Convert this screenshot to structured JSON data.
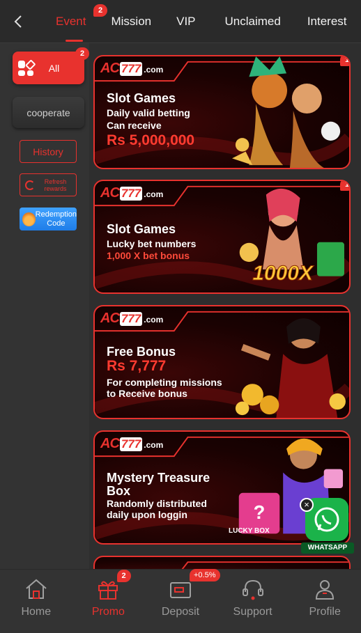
{
  "topbar": {
    "tabs": [
      {
        "label": "Event",
        "badge": "2",
        "active": true
      },
      {
        "label": "Mission"
      },
      {
        "label": "VIP"
      },
      {
        "label": "Unclaimed"
      },
      {
        "label": "Interest"
      }
    ]
  },
  "sidebar": {
    "all": {
      "label": "All",
      "badge": "2"
    },
    "cooperate": {
      "label": "cooperate"
    },
    "history": {
      "label": "History"
    },
    "refresh": {
      "label": "Refresh rewards"
    },
    "redeem": {
      "label": "Redemption Code"
    }
  },
  "banners": [
    {
      "badge": "1",
      "logo": {
        "ac": "AC",
        "num": "777",
        "domain": ".com"
      },
      "title": "Slot Games",
      "lines": [
        "Daily valid betting",
        "Can receive"
      ],
      "amount": "Rs 5,000,000"
    },
    {
      "badge": "1",
      "logo": {
        "ac": "AC",
        "num": "777",
        "domain": ".com"
      },
      "title": "Slot Games",
      "lines": [
        "Lucky bet numbers",
        "1,000 X bet bonus"
      ],
      "art_text": "1000X"
    },
    {
      "logo": {
        "ac": "AC",
        "num": "777",
        "domain": ".com"
      },
      "title": "Free Bonus",
      "amount": "Rs 7,777",
      "lines": [
        "For completing missions",
        "to Receive bonus"
      ]
    },
    {
      "logo": {
        "ac": "AC",
        "num": "777",
        "domain": ".com"
      },
      "title": "Mystery Treasure",
      "title2": "Box",
      "lines": [
        "Randomly distributed",
        "daily upon loggin"
      ],
      "art_text": "LUCKY BOX"
    }
  ],
  "whatsapp": {
    "label": "WHATSAPP",
    "close": "×"
  },
  "bottomnav": {
    "items": [
      {
        "label": "Home",
        "icon": "home-icon"
      },
      {
        "label": "Promo",
        "icon": "gift-icon",
        "badge": "2",
        "active": true
      },
      {
        "label": "Deposit",
        "icon": "wallet-icon",
        "badge": "+0.5%"
      },
      {
        "label": "Support",
        "icon": "headset-icon"
      },
      {
        "label": "Profile",
        "icon": "user-icon"
      }
    ]
  },
  "colors": {
    "accent": "#e8322e",
    "background": "#2e2e2e",
    "whatsapp": "#1bb34a"
  }
}
